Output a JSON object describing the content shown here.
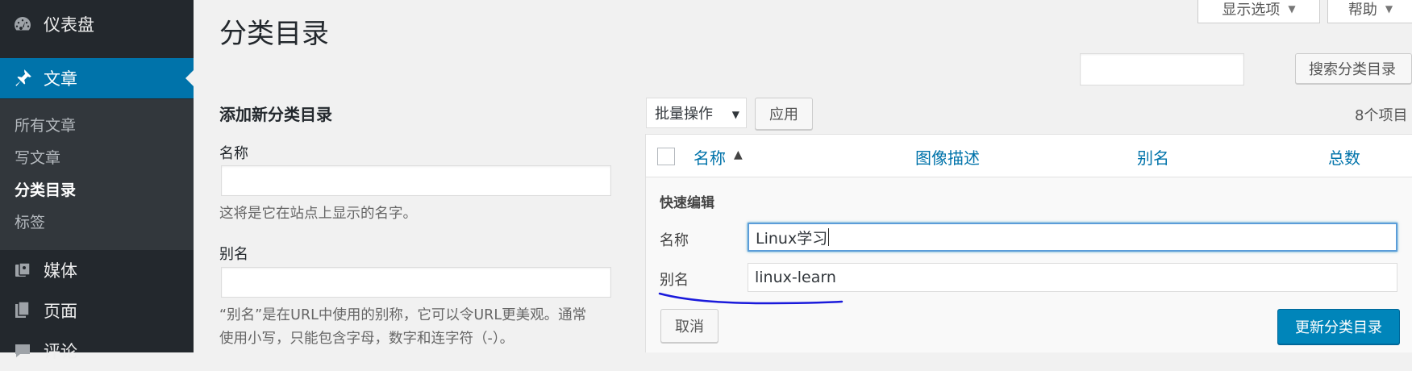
{
  "sidebar": {
    "dashboard": "仪表盘",
    "posts": "文章",
    "submenu": [
      "所有文章",
      "写文章",
      "分类目录",
      "标签"
    ],
    "media": "媒体",
    "pages": "页面",
    "comments": "评论"
  },
  "top": {
    "screen_options": "显示选项",
    "help": "帮助"
  },
  "page_title": "分类目录",
  "search": {
    "button": "搜索分类目录",
    "value": ""
  },
  "add_form": {
    "title": "添加新分类目录",
    "name_label": "名称",
    "name_hint": "这将是它在站点上显示的名字。",
    "slug_label": "别名",
    "slug_hint_1": "“别名”是在URL中使用的别称，它可以令URL更美观。通常",
    "slug_hint_2": "使用小写，只能包含字母，数字和连字符（-）。"
  },
  "bulk": {
    "selected": "批量操作",
    "apply": "应用",
    "count": "8个项目"
  },
  "table": {
    "columns": [
      "名称",
      "图像描述",
      "别名",
      "总数"
    ]
  },
  "quick_edit": {
    "title": "快速编辑",
    "name_label": "名称",
    "name_value": "Linux学习",
    "slug_label": "别名",
    "slug_value": "linux-learn",
    "cancel": "取消",
    "update": "更新分类目录"
  },
  "colors": {
    "sidebar": "#23282d",
    "accent": "#0073aa",
    "primary_button": "#0085ba",
    "annotation": "#1a1adb"
  },
  "icons": [
    "dashboard-icon",
    "pin-icon",
    "media-icon",
    "page-icon",
    "comment-icon"
  ]
}
